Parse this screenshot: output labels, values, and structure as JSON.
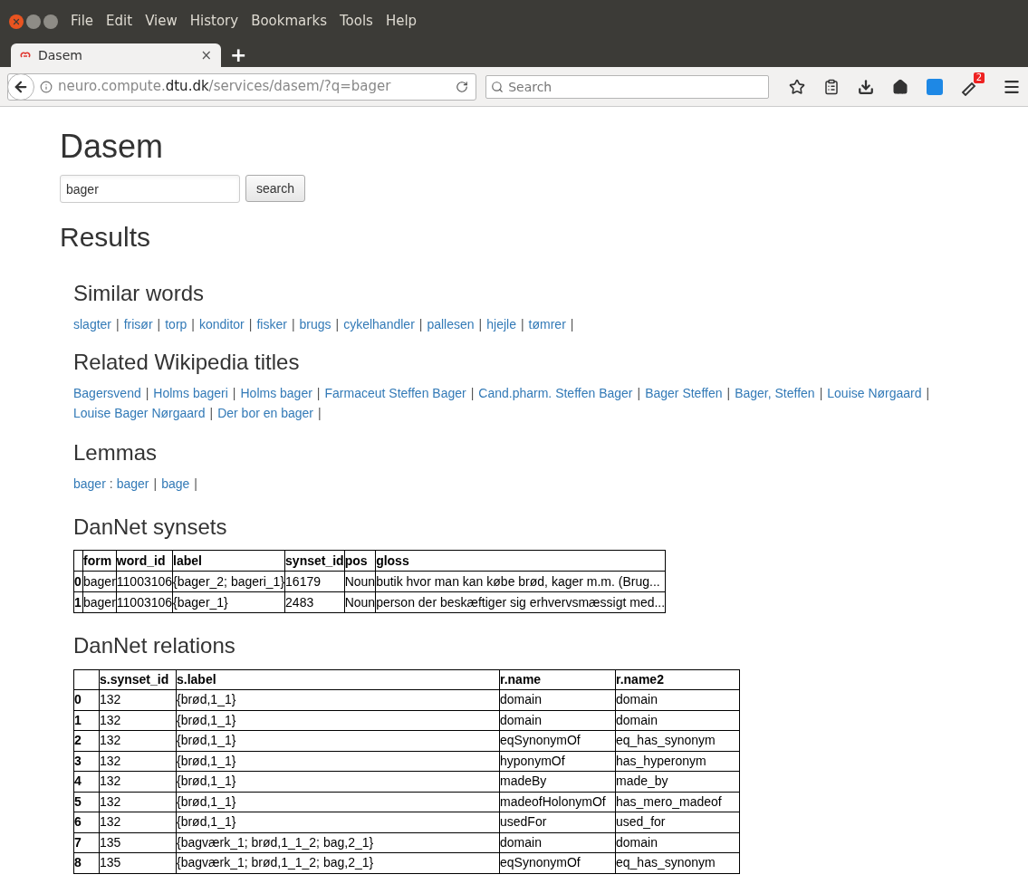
{
  "browser": {
    "menu": [
      "File",
      "Edit",
      "View",
      "History",
      "Bookmarks",
      "Tools",
      "Help"
    ],
    "tab": {
      "title": "Dasem",
      "close": "×",
      "new": "+"
    },
    "url": {
      "prefix": "neuro.compute.",
      "domain": "dtu.dk",
      "path": "/services/dasem/?q=bager"
    },
    "search": {
      "placeholder": "Search"
    },
    "badge": "2"
  },
  "page": {
    "title": "Dasem",
    "query": {
      "value": "bager"
    },
    "search_button": "search",
    "results_heading": "Results",
    "separator": "|",
    "similar": {
      "heading": "Similar words",
      "links": [
        "slagter",
        "frisør",
        "torp",
        "konditor",
        "fisker",
        "brugs",
        "cykelhandler",
        "pallesen",
        "hjejle",
        "tømrer"
      ]
    },
    "wikipedia": {
      "heading": "Related Wikipedia titles",
      "links": [
        "Bagersvend",
        "Holms bageri",
        "Holms bager",
        "Farmaceut Steffen Bager",
        "Cand.pharm. Steffen Bager",
        "Bager Steffen",
        "Bager, Steffen",
        "Louise Nørgaard",
        "Louise Bager Nørgaard",
        "Der bor en bager"
      ]
    },
    "lemmas": {
      "heading": "Lemmas",
      "word": "bager",
      "colon": ":",
      "links": [
        "bager",
        "bage"
      ]
    },
    "synsets": {
      "heading": "DanNet synsets",
      "columns": [
        "form",
        "word_id",
        "label",
        "synset_id",
        "pos",
        "gloss"
      ],
      "rows": [
        {
          "index": "0",
          "cells": [
            "bager",
            "11003106",
            "{bager_2; bageri_1}",
            "16179",
            "Noun",
            "butik hvor man kan købe brød, kager m.m. (Brug..."
          ]
        },
        {
          "index": "1",
          "cells": [
            "bager",
            "11003106",
            "{bager_1}",
            "2483",
            "Noun",
            "person der beskæftiger sig erhvervsmæssigt med..."
          ]
        }
      ]
    },
    "relations": {
      "heading": "DanNet relations",
      "columns": [
        "s.synset_id",
        "s.label",
        "r.name",
        "r.name2"
      ],
      "rows": [
        {
          "index": "0",
          "cells": [
            "132",
            "{brød,1_1}",
            "domain",
            "domain"
          ]
        },
        {
          "index": "1",
          "cells": [
            "132",
            "{brød,1_1}",
            "domain",
            "domain"
          ]
        },
        {
          "index": "2",
          "cells": [
            "132",
            "{brød,1_1}",
            "eqSynonymOf",
            "eq_has_synonym"
          ]
        },
        {
          "index": "3",
          "cells": [
            "132",
            "{brød,1_1}",
            "hyponymOf",
            "has_hyperonym"
          ]
        },
        {
          "index": "4",
          "cells": [
            "132",
            "{brød,1_1}",
            "madeBy",
            "made_by"
          ]
        },
        {
          "index": "5",
          "cells": [
            "132",
            "{brød,1_1}",
            "madeofHolonymOf",
            "has_mero_madeof"
          ]
        },
        {
          "index": "6",
          "cells": [
            "132",
            "{brød,1_1}",
            "usedFor",
            "used_for"
          ]
        },
        {
          "index": "7",
          "cells": [
            "135",
            "{bagværk_1; brød,1_1_2; bag,2_1}",
            "domain",
            "domain"
          ]
        },
        {
          "index": "8",
          "cells": [
            "135",
            "{bagværk_1; brød,1_1_2; bag,2_1}",
            "eqSynonymOf",
            "eq_has_synonym"
          ]
        }
      ]
    }
  }
}
